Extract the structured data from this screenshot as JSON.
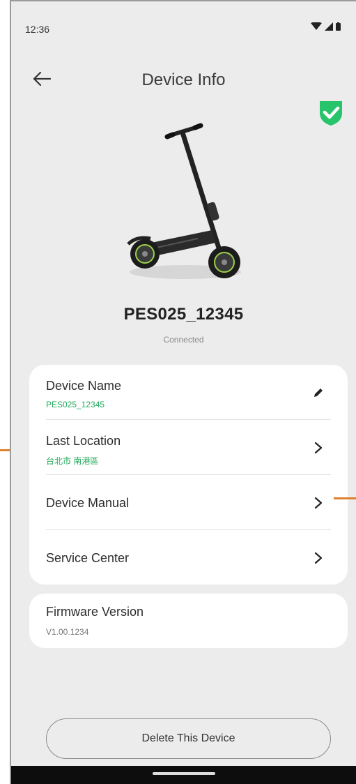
{
  "status_bar": {
    "time": "12:36"
  },
  "header": {
    "title": "Device Info"
  },
  "device": {
    "name": "PES025_12345",
    "status": "Connected"
  },
  "info_rows": [
    {
      "title": "Device Name",
      "value": "PES025_12345",
      "action_icon": "pencil-icon"
    },
    {
      "title": "Last Location",
      "value": "台北市 南港區",
      "action_icon": "chevron-right-icon"
    },
    {
      "title": "Device Manual",
      "action_icon": "chevron-right-icon"
    },
    {
      "title": "Service Center",
      "action_icon": "chevron-right-icon"
    }
  ],
  "firmware": {
    "title": "Firmware Version",
    "value": "V1.00.1234"
  },
  "delete_button": {
    "label": "Delete This Device"
  },
  "colors": {
    "accent_green": "#22a85a",
    "callout_orange": "#e0812f",
    "background": "#ececec"
  }
}
